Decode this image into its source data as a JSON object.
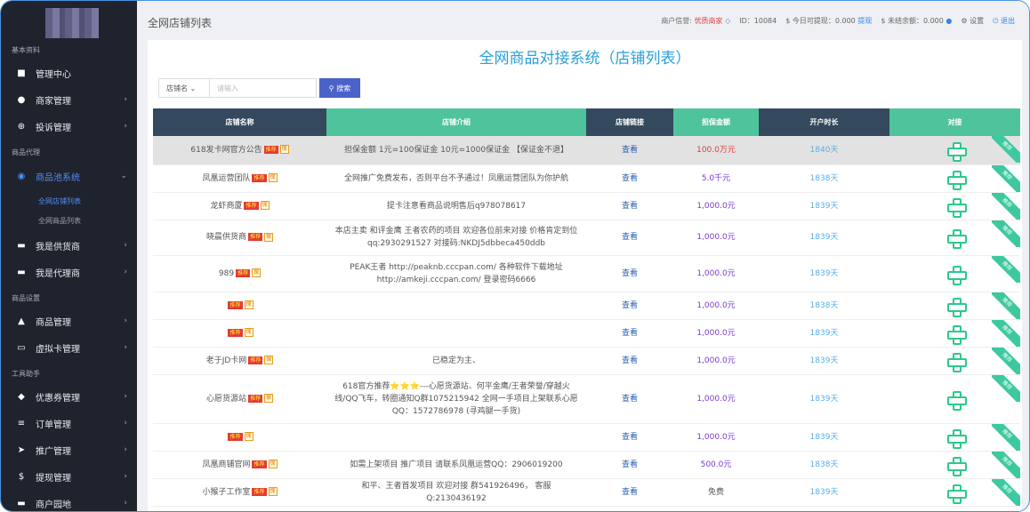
{
  "sidebar": {
    "sections": [
      "基本资料",
      "商品代理",
      "商品设置",
      "工具助手"
    ],
    "items": [
      {
        "label": "管理中心",
        "icon": "dashboard-icon",
        "glyph": "■",
        "chev": ""
      },
      {
        "label": "商家管理",
        "icon": "user-icon",
        "glyph": "●",
        "chev": "›"
      },
      {
        "label": "投诉管理",
        "icon": "lifebuoy-icon",
        "glyph": "⊕",
        "chev": "›"
      },
      {
        "label": "商品池系统",
        "icon": "eye-icon",
        "glyph": "◉",
        "chev": "⌄"
      },
      {
        "label": "我是供货商",
        "icon": "car-icon",
        "glyph": "▬",
        "chev": "›"
      },
      {
        "label": "我是代理商",
        "icon": "car-icon",
        "glyph": "▬",
        "chev": "›"
      },
      {
        "label": "商品管理",
        "icon": "home-icon",
        "glyph": "▲",
        "chev": "›"
      },
      {
        "label": "虚拟卡管理",
        "icon": "credit-card-icon",
        "glyph": "▭",
        "chev": "›"
      },
      {
        "label": "优惠券管理",
        "icon": "tag-icon",
        "glyph": "◆",
        "chev": "›"
      },
      {
        "label": "订单管理",
        "icon": "list-icon",
        "glyph": "≡",
        "chev": "›"
      },
      {
        "label": "推广管理",
        "icon": "paper-plane-icon",
        "glyph": "➤",
        "chev": "›"
      },
      {
        "label": "提现管理",
        "icon": "dollar-icon",
        "glyph": "$",
        "chev": "›"
      },
      {
        "label": "商户园地",
        "icon": "car-icon",
        "glyph": "▬",
        "chev": "›"
      }
    ],
    "subitems": [
      "全网店铺列表",
      "全网商品列表"
    ]
  },
  "topbar": {
    "page_title": "全网店铺列表",
    "credit_label": "商户信誉:",
    "credit_value": "优质商家",
    "id_text": "ID：10084",
    "withdraw_label": "$ 今日可提现：0.000",
    "withdraw_link": "提现",
    "balance_label": "$ 未结余额：0.000",
    "settings": "设置",
    "logout": "退出"
  },
  "main": {
    "title": "全网商品对接系统（店铺列表）",
    "search": {
      "select": "店铺名",
      "placeholder": "请输入",
      "button": "搜索"
    },
    "columns": [
      "店铺名称",
      "店铺介绍",
      "店铺链接",
      "担保金额",
      "开户时长",
      "对接"
    ],
    "badge_text": "推荐",
    "bao_text": "保",
    "link_text": "查看",
    "ribbon_text": "推荐",
    "rows": [
      {
        "name": "618发卡网官方公告",
        "intro": "担保金额 1元=100保证金 10元=1000保证金 【保证金不退】",
        "amount": "100.0万元",
        "days": "1840天"
      },
      {
        "name": "凤凰运营团队",
        "intro": "全网推广免费发布，否则平台不予通过！凤凰运营团队为你护航",
        "amount": "5.0千元",
        "days": "1838天"
      },
      {
        "name": "龙虾商厦",
        "intro": "提卡注意看商品说明售后q978078617",
        "amount": "1,000.0元",
        "days": "1839天"
      },
      {
        "name": "晓晨供货商",
        "intro": "本店主卖 和评金鹰 王者农药的项目 欢迎各位前来对接 价格肯定到位 qq:2930291527 对接码:NKDJ5dbbeca450ddb",
        "amount": "1,000.0元",
        "days": "1839天"
      },
      {
        "name": "989",
        "intro": "PEAK王者 http://peaknb.cccpan.com/ 各种软件下载地址 http://amkeji.cccpan.com/ 登录密码6666",
        "amount": "1,000.0元",
        "days": "1839天"
      },
      {
        "name": "",
        "intro": "",
        "amount": "1,000.0元",
        "days": "1838天"
      },
      {
        "name": "",
        "intro": "",
        "amount": "1,000.0元",
        "days": "1839天"
      },
      {
        "name": "老于JD卡网",
        "intro": "已稳定为主、",
        "amount": "1,000.0元",
        "days": "1839天"
      },
      {
        "name": "心愿货源站",
        "intro": "618官方推荐⭐⭐⭐---心愿货源站、何平金鹰/王者荣誉/穿越火线/QQ飞车，转圈通知Q群1075215942 全网一手项目上架联系心愿QQ：1572786978 (寻鸡腿一手货)",
        "amount": "1,000.0元",
        "days": "1839天"
      },
      {
        "name": "",
        "intro": "",
        "amount": "1,000.0元",
        "days": "1839天"
      },
      {
        "name": "凤凰商铺官网",
        "intro": "如需上架项目 推广项目 请联系凤凰运营QQ：2906019200",
        "amount": "500.0元",
        "days": "1838天"
      },
      {
        "name": "小猴子工作室",
        "intro": "和平、王者首发项目 欢迎对接 群541926496， 客服Q:2130436192",
        "amount": "免费",
        "days": "1839天"
      }
    ]
  },
  "colors": {
    "sidebar_bg": "#1f232d",
    "accent": "#4f8ef7",
    "title": "#2a9fd8",
    "green": "#4fc39c",
    "dark_header": "#34495e"
  }
}
